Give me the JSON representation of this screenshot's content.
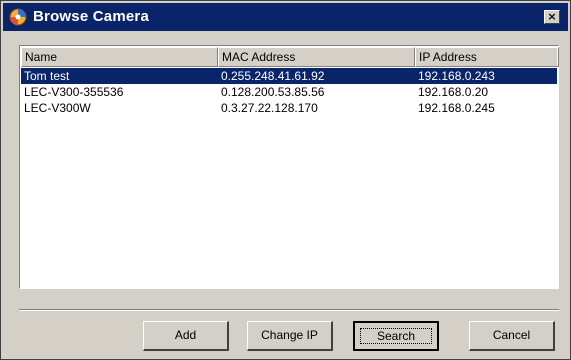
{
  "window": {
    "title": "Browse Camera",
    "close_glyph": "×",
    "app_icon": "camera-app-icon"
  },
  "table": {
    "columns": [
      "Name",
      "MAC Address",
      "IP Address"
    ],
    "rows": [
      {
        "name": "Tom test",
        "mac": "0.255.248.41.61.92",
        "ip": "192.168.0.243",
        "selected": true
      },
      {
        "name": "LEC-V300-355536",
        "mac": "0.128.200.53.85.56",
        "ip": "192.168.0.20",
        "selected": false
      },
      {
        "name": "LEC-V300W",
        "mac": "0.3.27.22.128.170",
        "ip": "192.168.0.245",
        "selected": false
      }
    ]
  },
  "buttons": {
    "add_label": "Add",
    "change_ip_label": "Change IP",
    "search_label": "Search",
    "cancel_label": "Cancel"
  },
  "colors": {
    "title_bar": "#0a246a",
    "selection": "#0a246a",
    "face": "#d4d0c8"
  }
}
